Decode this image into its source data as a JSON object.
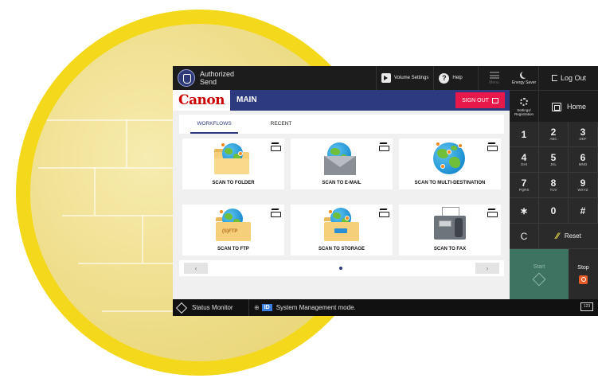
{
  "header": {
    "auth_label": "Authorized\nSend",
    "volume_label": "Volume Settings",
    "help_label": "Help",
    "menu_label": "Menu"
  },
  "brand": {
    "logo_text": "Canon",
    "main_title": "MAIN",
    "signout_label": "SIGN OUT"
  },
  "tabs": [
    {
      "label": "WORKFLOWS",
      "active": true
    },
    {
      "label": "RECENT",
      "active": false
    }
  ],
  "tiles": [
    {
      "label": "SCAN TO FOLDER",
      "icon": "folder-globe-icon"
    },
    {
      "label": "SCAN TO E-MAIL",
      "icon": "envelope-globe-icon"
    },
    {
      "label": "SCAN TO MULTI-DESTINATION",
      "icon": "globe-pins-icon"
    },
    {
      "label": "SCAN TO FTP",
      "icon": "ftp-folder-icon",
      "ftp_text": "(S)FTP"
    },
    {
      "label": "SCAN TO STORAGE",
      "icon": "usb-folder-icon"
    },
    {
      "label": "SCAN TO FAX",
      "icon": "fax-machine-icon"
    }
  ],
  "pager": {
    "prev": "‹",
    "next": "›"
  },
  "status": {
    "monitor_label": "Status Monitor",
    "id_badge": "ID",
    "message": "System Management mode."
  },
  "right_panel": {
    "energy_label": "Energy Saver",
    "logout_label": "Log Out",
    "settings_label": "Settings/\nRegistration",
    "home_label": "Home",
    "keys": [
      {
        "d": "1",
        "l": ""
      },
      {
        "d": "2",
        "l": "ABC"
      },
      {
        "d": "3",
        "l": "DEF"
      },
      {
        "d": "4",
        "l": "GHI"
      },
      {
        "d": "5",
        "l": "JKL"
      },
      {
        "d": "6",
        "l": "MNO"
      },
      {
        "d": "7",
        "l": "PQRS"
      },
      {
        "d": "8",
        "l": "TUV"
      },
      {
        "d": "9",
        "l": "WXYZ"
      },
      {
        "d": "∗",
        "l": ""
      },
      {
        "d": "0",
        "l": ""
      },
      {
        "d": "#",
        "l": ""
      }
    ],
    "clear_label": "C",
    "reset_label": "Reset",
    "start_label": "Start",
    "stop_label": "Stop",
    "counter_label": "123"
  },
  "colors": {
    "brand_blue": "#2d3a7f",
    "signout_red": "#e8184a",
    "start_green": "#3d7360",
    "stop_orange": "#e85a28",
    "deco_yellow": "#f4d81c"
  }
}
